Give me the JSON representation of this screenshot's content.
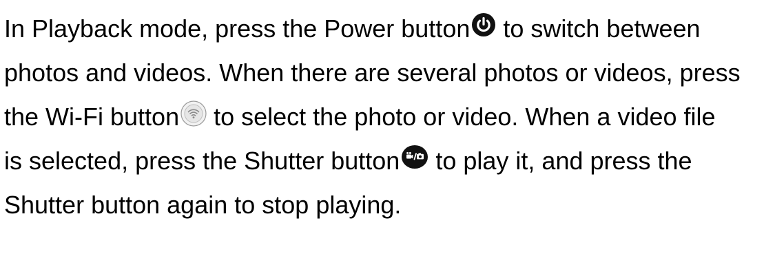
{
  "paragraph": {
    "line1_a": "In Playback mode, press the Power button",
    "line1_b": " to switch between",
    "line2": "photos and videos. When there are several photos or videos, press",
    "line3_a": "the Wi-Fi button",
    "line3_b": " to select the photo or video. When a video file",
    "line4_a": "is selected, press the Shutter button",
    "line4_b": " to play it, and press the",
    "line5": "Shutter button again to stop playing."
  },
  "icons": {
    "power": "power-icon",
    "wifi": "wifi-icon",
    "shutter": "shutter-icon"
  },
  "colors": {
    "text": "#000000",
    "icon_dark": "#111111",
    "icon_light": "#e6e6e6"
  }
}
